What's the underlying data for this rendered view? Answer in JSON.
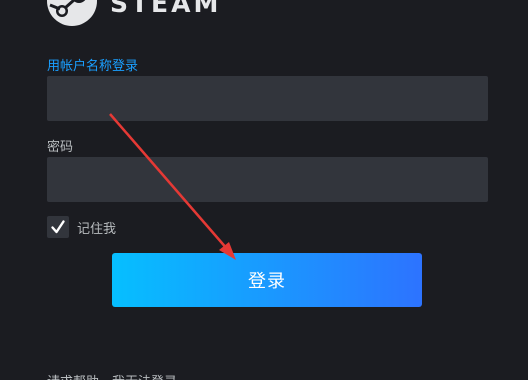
{
  "app": {
    "brand": "STEAM"
  },
  "login_form": {
    "account_label": "用帐户名称登录",
    "account_value": "",
    "password_label": "密码",
    "password_value": "",
    "remember_label": "记住我",
    "remember_checked": true,
    "submit_label": "登录",
    "help_link": "请求帮助，我无法登录"
  },
  "annotation": {
    "type": "red-arrow",
    "color": "#e53935",
    "points_to": "login-button"
  },
  "colors": {
    "background": "#1b1c21",
    "field_background": "#32353c",
    "accent_blue": "#1a9fff",
    "button_gradient_start": "#06bfff",
    "button_gradient_end": "#2d73ff"
  },
  "icons": {
    "logo": "steam-logo-icon",
    "checkbox": "checkmark-icon"
  }
}
